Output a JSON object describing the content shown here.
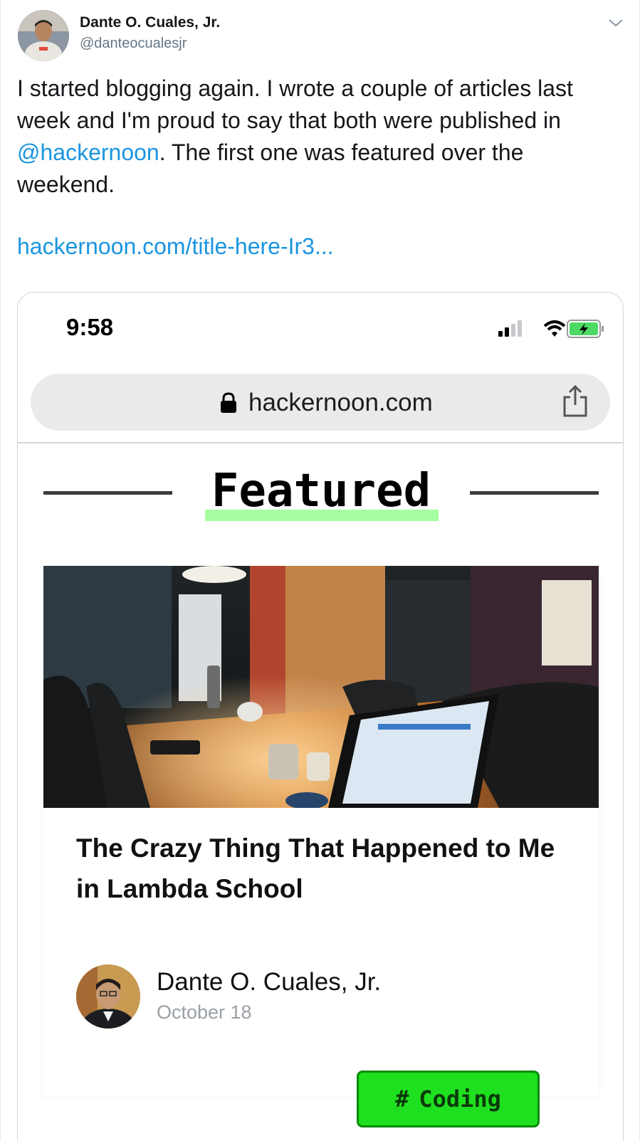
{
  "tweet": {
    "author_name": "Dante O. Cuales, Jr.",
    "author_handle": "@danteocualesjr",
    "text_before_mention": "I started blogging again. I wrote a couple of articles last week and I'm proud to say that both were published in ",
    "mention": "@hackernoon",
    "text_after_mention": ". The first one was featured over the weekend.",
    "link": "hackernoon.com/title-here-Ir3..."
  },
  "screenshot": {
    "status_time": "9:58",
    "url": "hackernoon.com",
    "section_title": "Featured",
    "article": {
      "title": "The Crazy Thing That Happened to Me in Lambda School",
      "author": "Dante O. Cuales, Jr.",
      "date": "October 18",
      "tag": "Coding"
    }
  },
  "colors": {
    "link": "#1b95e0",
    "handle": "#657786",
    "featured_highlight": "#a6ffa0",
    "tag_bg": "#1fe01f"
  }
}
